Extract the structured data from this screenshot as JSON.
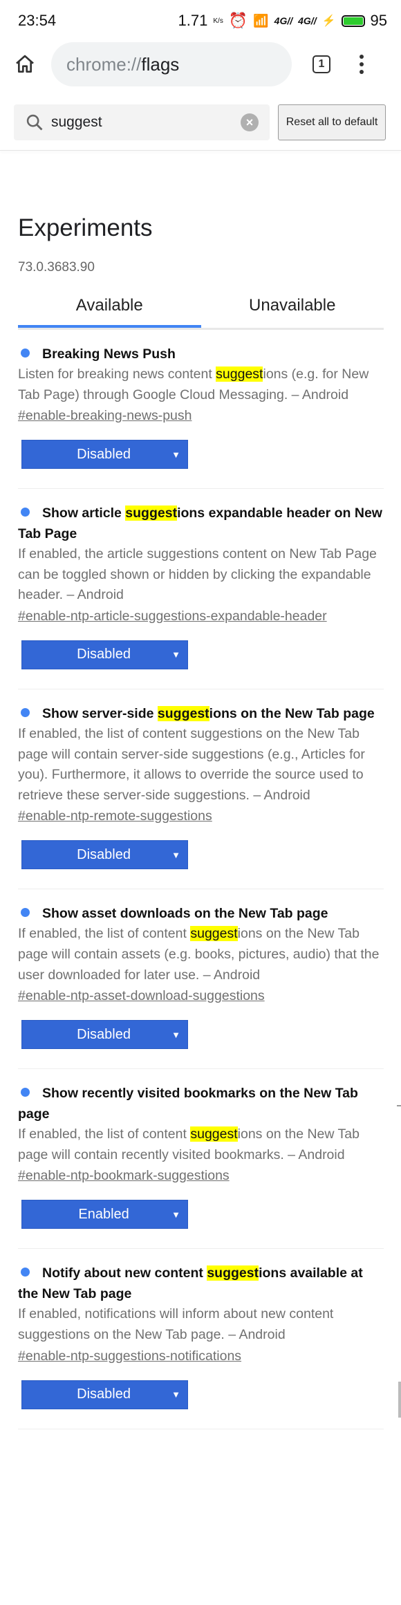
{
  "status_bar": {
    "time": "23:54",
    "network_speed": "1.71",
    "speed_unit": "K/s",
    "battery": "95",
    "battery_color": "#2ecc2e"
  },
  "toolbar": {
    "url_scheme": "chrome://",
    "url_path": "flags",
    "tab_count": "1"
  },
  "search": {
    "value": "suggest",
    "reset_label": "Reset all to default"
  },
  "page": {
    "title": "Experiments",
    "version": "73.0.3683.90",
    "tabs": [
      {
        "label": "Available",
        "active": true
      },
      {
        "label": "Unavailable",
        "active": false
      }
    ]
  },
  "accent": "#4285f4",
  "highlight_color": "#ffff00",
  "experiments": [
    {
      "title_pre": "Breaking News Push",
      "title_hl": "",
      "title_post": "",
      "desc_pre": "Listen for breaking news content ",
      "desc_hl": "suggest",
      "desc_post": "ions (e.g. for New Tab Page) through Google Cloud Messaging. – Android",
      "link": "#enable-breaking-news-push",
      "state": "Disabled"
    },
    {
      "title_pre": "Show article ",
      "title_hl": "suggest",
      "title_post": "ions expandable header on New Tab Page",
      "desc_pre": "If enabled, the article suggestions content on New Tab Page can be toggled shown or hidden by clicking the expandable header. – Android",
      "desc_hl": "",
      "desc_post": "",
      "link": "#enable-ntp-article-suggestions-expandable-header",
      "state": "Disabled"
    },
    {
      "title_pre": "Show server-side ",
      "title_hl": "suggest",
      "title_post": "ions on the New Tab page",
      "desc_pre": "If enabled, the list of content suggestions on the New Tab page will contain server-side suggestions (e.g., Articles for you). Furthermore, it allows to override the source used to retrieve these server-side suggestions. – Android",
      "desc_hl": "",
      "desc_post": "",
      "link": "#enable-ntp-remote-suggestions",
      "state": "Disabled"
    },
    {
      "title_pre": "Show asset downloads on the New Tab page",
      "title_hl": "",
      "title_post": "",
      "desc_pre": "If enabled, the list of content ",
      "desc_hl": "suggest",
      "desc_post": "ions on the New Tab page will contain assets (e.g. books, pictures, audio) that the user downloaded for later use. – Android",
      "link": "#enable-ntp-asset-download-suggestions",
      "state": "Disabled"
    },
    {
      "title_pre": "Show recently visited bookmarks on the New Tab page",
      "title_hl": "",
      "title_post": "",
      "desc_pre": "If enabled, the list of content ",
      "desc_hl": "suggest",
      "desc_post": "ions on the New Tab page will contain recently visited bookmarks. – Android",
      "link": "#enable-ntp-bookmark-suggestions",
      "state": "Enabled"
    },
    {
      "title_pre": "Notify about new content ",
      "title_hl": "suggest",
      "title_post": "ions available at the New Tab page",
      "desc_pre": "If enabled, notifications will inform about new content suggestions on the New Tab page. – Android",
      "desc_hl": "",
      "desc_post": "",
      "link": "#enable-ntp-suggestions-notifications",
      "state": "Disabled"
    }
  ]
}
